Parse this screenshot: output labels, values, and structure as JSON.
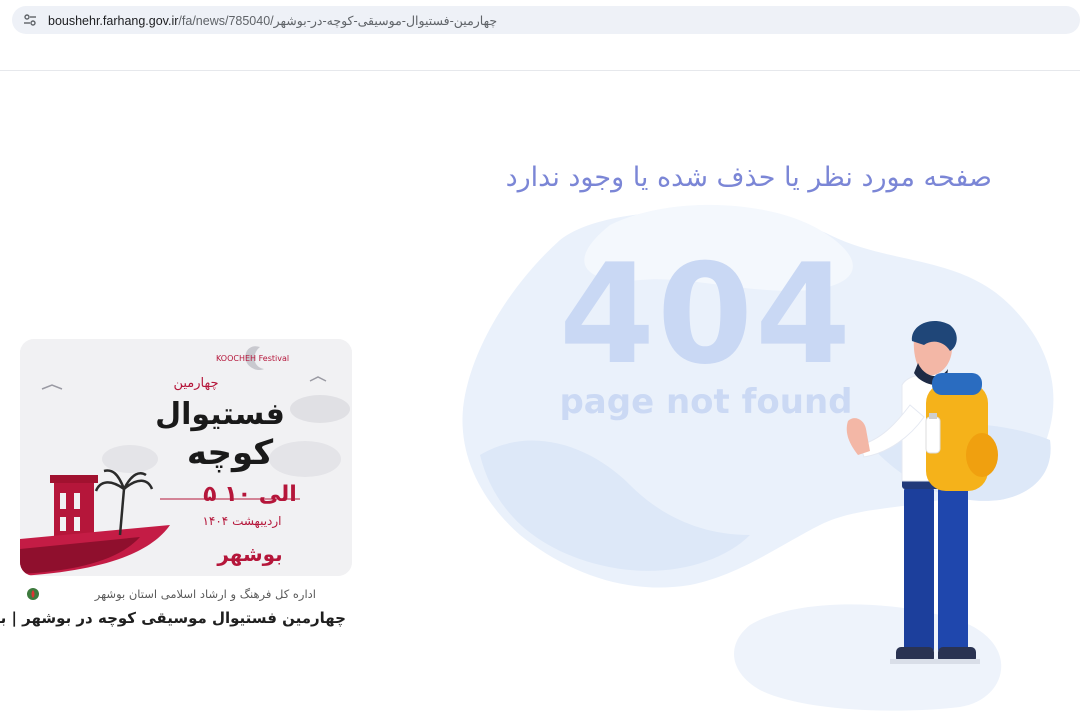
{
  "browser": {
    "url_host": "boushehr.farhang.gov.ir",
    "url_path": "/fa/news/785040/چهارمین-فستیوال-موسیقی-کوچه-در-بوشهر",
    "site_info_icon": "tune-icon"
  },
  "error": {
    "message": "صفحه مورد نظر یا حذف شده یا وجود ندارد",
    "code": "404",
    "code_text": "page not found"
  },
  "card": {
    "poster": {
      "text_line1": "فستیوال",
      "text_line2": "کوچه",
      "dates": "۵ الی ۱۰",
      "month": "اردیبهشت ۱۴۰۴",
      "city": "بوشهر",
      "ordinal": "چهارمین",
      "badge": "KOOCHEH Festival"
    },
    "source": "اداره کل فرهنگ و ارشاد اسلامی استان بوشهر",
    "source_icon": "emblem-icon",
    "headline": "چهارمین فستیوال موسیقی کوچه در بوشهر | بوشهر"
  },
  "colors": {
    "title": "#7b86d6",
    "watermark": "#c9d8f4",
    "blob": "#eaf1fb",
    "poster_red": "#b5163a",
    "backpack": "#f5b21a",
    "pants": "#1c3f9c"
  }
}
